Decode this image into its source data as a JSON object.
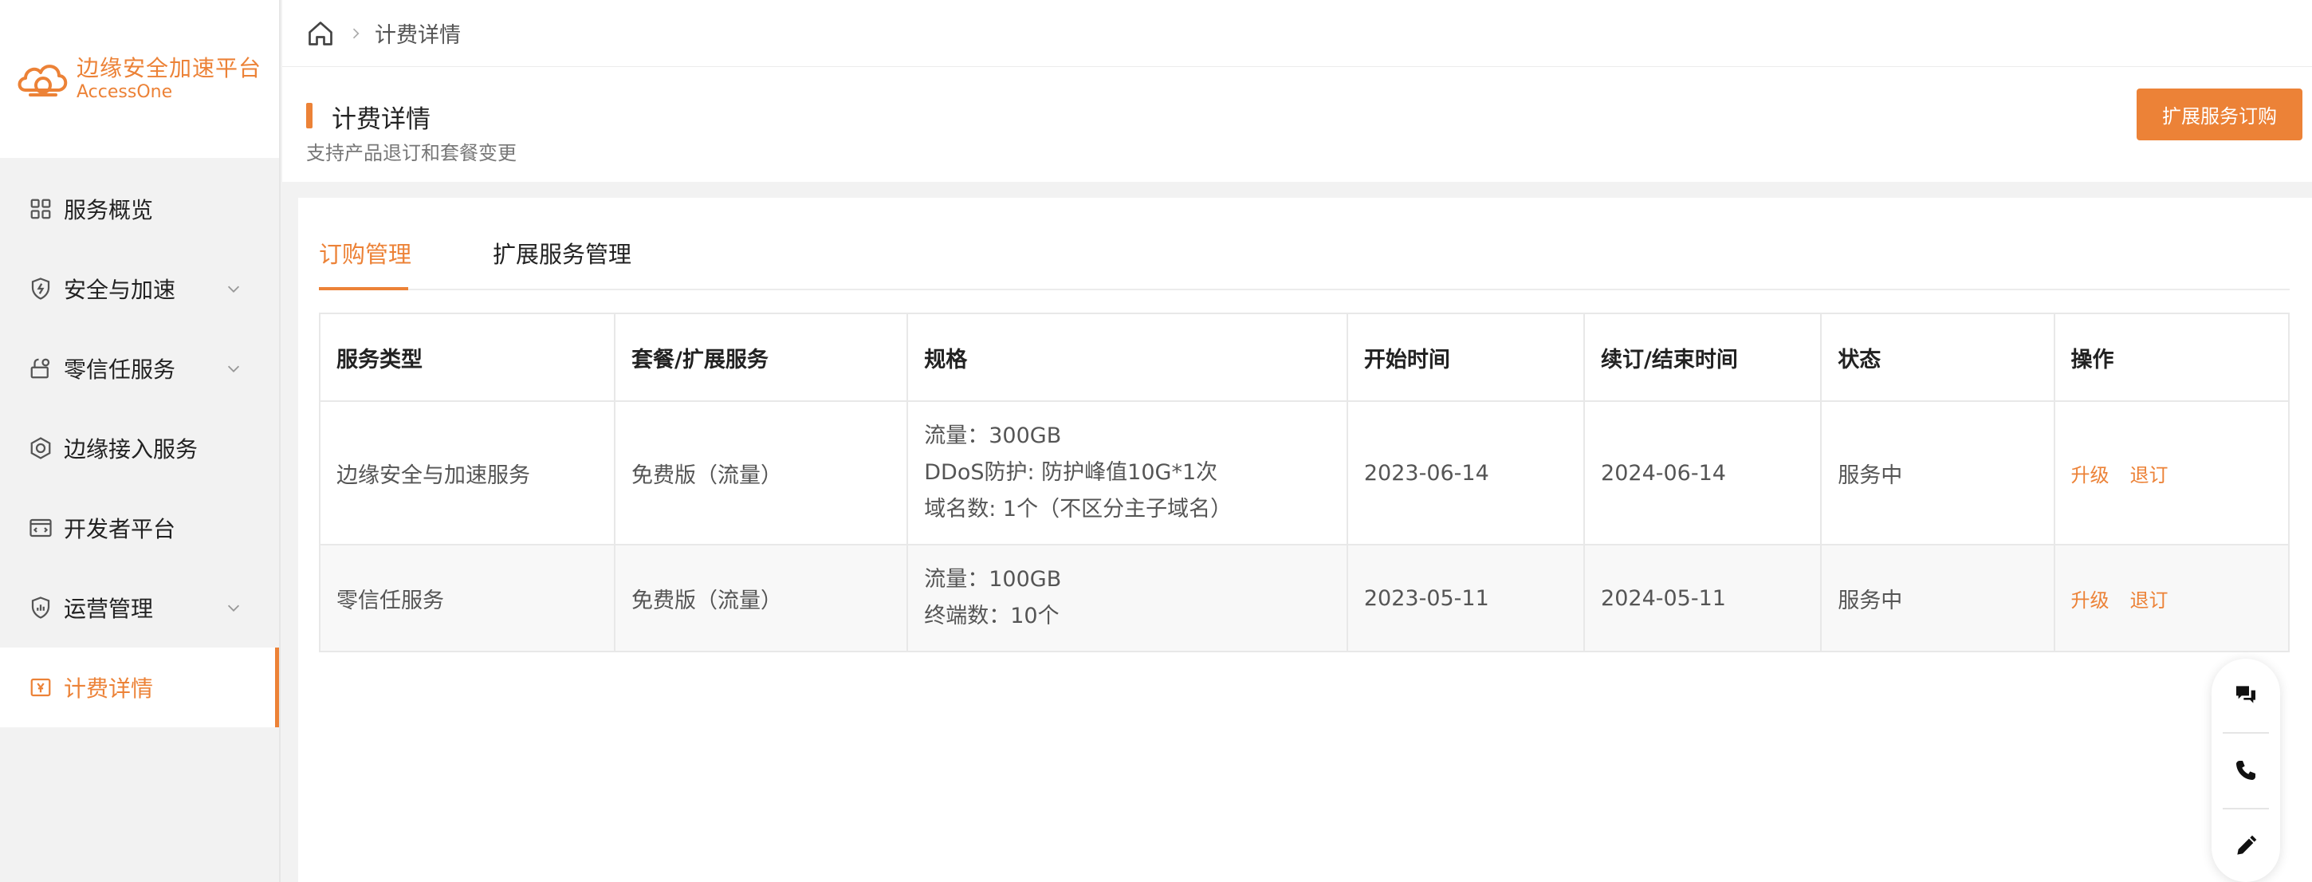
{
  "brand": {
    "title": "边缘安全加速平台",
    "subtitle": "AccessOne",
    "accent_color": "#ec8237"
  },
  "sidebar": {
    "items": [
      {
        "label": "服务概览",
        "icon": "grid-icon",
        "expandable": false,
        "active": false
      },
      {
        "label": "安全与加速",
        "icon": "shield-icon",
        "expandable": true,
        "active": false
      },
      {
        "label": "零信任服务",
        "icon": "lock-user-icon",
        "expandable": true,
        "active": false
      },
      {
        "label": "边缘接入服务",
        "icon": "edge-access-icon",
        "expandable": false,
        "active": false
      },
      {
        "label": "开发者平台",
        "icon": "code-window-icon",
        "expandable": false,
        "active": false
      },
      {
        "label": "运营管理",
        "icon": "chart-shield-icon",
        "expandable": true,
        "active": false
      },
      {
        "label": "计费详情",
        "icon": "yuan-icon",
        "expandable": false,
        "active": true
      }
    ]
  },
  "breadcrumb": {
    "home_icon": "home-icon",
    "current": "计费详情"
  },
  "header": {
    "title": "计费详情",
    "description": "支持产品退订和套餐变更",
    "expand_button": "扩展服务订购"
  },
  "tabs": [
    {
      "label": "订购管理",
      "active": true
    },
    {
      "label": "扩展服务管理",
      "active": false
    }
  ],
  "table": {
    "columns": [
      "服务类型",
      "套餐/扩展服务",
      "规格",
      "开始时间",
      "续订/结束时间",
      "状态",
      "操作"
    ],
    "rows": [
      {
        "service": "边缘安全与加速服务",
        "plan": "免费版（流量）",
        "spec": [
          "流量：300GB",
          "DDoS防护: 防护峰值10G*1次",
          "域名数: 1个（不区分主子域名）"
        ],
        "start": "2023-06-14",
        "end": "2024-06-14",
        "status": "服务中",
        "actions": [
          "升级",
          "退订"
        ]
      },
      {
        "service": "零信任服务",
        "plan": "免费版（流量）",
        "spec": [
          "流量：100GB",
          "终端数：10个"
        ],
        "start": "2023-05-11",
        "end": "2024-05-11",
        "status": "服务中",
        "actions": [
          "升级",
          "退订"
        ]
      }
    ]
  },
  "float_tools": [
    "chat-icon",
    "phone-icon",
    "edit-icon"
  ]
}
